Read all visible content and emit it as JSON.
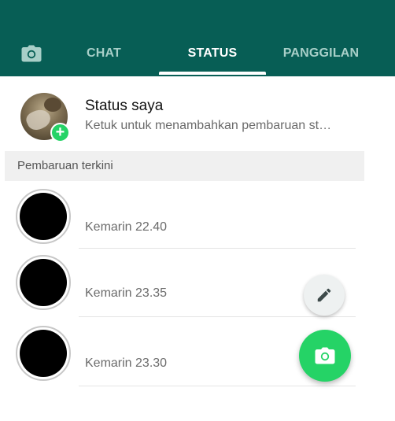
{
  "tabs": {
    "camera_icon": "camera-icon",
    "chat": "CHAT",
    "status": "STATUS",
    "calls": "PANGGILAN",
    "active": "STATUS"
  },
  "my_status": {
    "title": "Status saya",
    "subtitle": "Ketuk untuk menambahkan pembaruan st…",
    "badge_icon": "plus-icon"
  },
  "recent": {
    "header": "Pembaruan terkini",
    "items": [
      {
        "time": "Kemarin 22.40"
      },
      {
        "time": "Kemarin 23.35"
      },
      {
        "time": "Kemarin 23.30"
      }
    ]
  },
  "fabs": {
    "edit_icon": "pencil-icon",
    "camera_icon": "camera-icon"
  },
  "colors": {
    "app_bar": "#075e55",
    "accent": "#25d366",
    "tab_inactive": "#a8cfc8"
  }
}
